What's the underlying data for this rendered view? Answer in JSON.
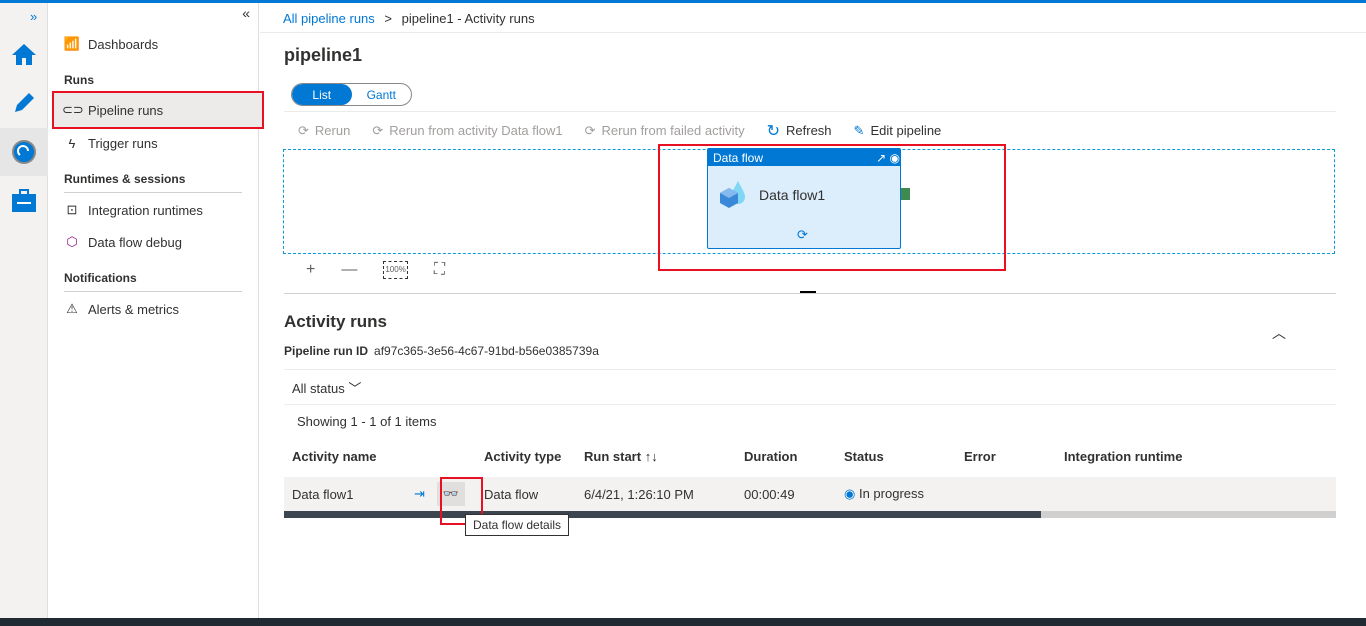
{
  "nav": {
    "expand": "»",
    "collapse": "«",
    "items": [
      {
        "label": "Dashboards"
      },
      {
        "label": "Pipeline runs"
      },
      {
        "label": "Trigger runs"
      },
      {
        "label": "Integration runtimes"
      },
      {
        "label": "Data flow debug"
      },
      {
        "label": "Alerts & metrics"
      }
    ],
    "sections": [
      "Runs",
      "Runtimes & sessions",
      "Notifications"
    ]
  },
  "breadcrumb": {
    "root": "All pipeline runs",
    "sep": ">",
    "current": "pipeline1 - Activity runs"
  },
  "title": "pipeline1",
  "view_toggle": {
    "list": "List",
    "gantt": "Gantt"
  },
  "toolbar": {
    "rerun": "Rerun",
    "rerun_from": "Rerun from activity Data flow1",
    "rerun_failed": "Rerun from failed activity",
    "refresh": "Refresh",
    "edit": "Edit pipeline"
  },
  "node": {
    "type": "Data flow",
    "name": "Data flow1"
  },
  "zoom": {
    "in": "+",
    "out": "—",
    "reset": "100%",
    "fit": "⛶"
  },
  "activity": {
    "title": "Activity runs",
    "run_id_label": "Pipeline run ID",
    "run_id": "af97c365-3e56-4c67-91bd-b56e0385739a",
    "filter": "All status",
    "showing": "Showing 1 - 1 of 1 items",
    "columns": [
      "Activity name",
      "Activity type",
      "Run start",
      "Duration",
      "Status",
      "Error",
      "Integration runtime"
    ],
    "rows": [
      {
        "name": "Data flow1",
        "type": "Data flow",
        "start": "6/4/21, 1:26:10 PM",
        "duration": "00:00:49",
        "status": "In progress",
        "error": "",
        "runtime": ""
      }
    ],
    "tooltip": "Data flow details"
  },
  "colors": {
    "accent": "#0078d4",
    "highlight": "#e81123"
  }
}
